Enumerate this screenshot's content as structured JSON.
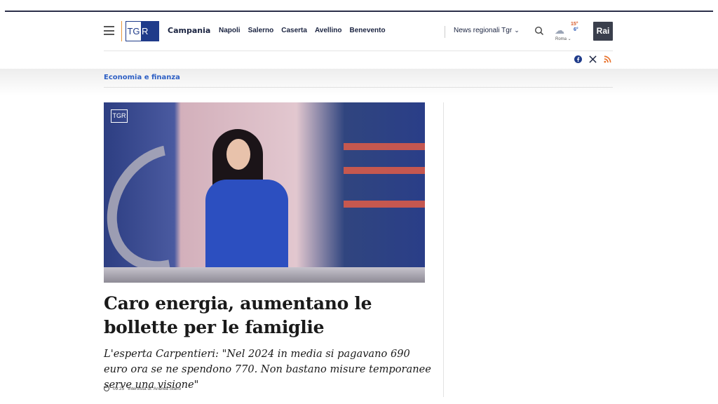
{
  "header": {
    "logo_tg": "TG",
    "logo_r": "R",
    "region": "Campania",
    "cities": [
      "Napoli",
      "Salerno",
      "Caserta",
      "Avellino",
      "Benevento"
    ],
    "news_regionali": "News regionali Tgr",
    "weather": {
      "temp_high": "15°",
      "temp_low": "6°",
      "city": "Roma"
    },
    "broadcaster_logo": "Rai"
  },
  "socials": [
    "facebook-icon",
    "x-icon",
    "rss-icon"
  ],
  "category": "Economia e finanza",
  "article": {
    "image_logo": "TGR",
    "headline": "Caro energia, aumentano le bollette per le famiglie",
    "subhead": "L'esperta Carpentieri: \"Nel 2024 in media si pagavano 690 euro ora se ne spendono 770. Non bastano misure temporanee serve una visione\"",
    "duration": "09:25",
    "credit": "Intervista di: Andrea Siano"
  },
  "colors": {
    "accent": "#2d5fc4",
    "brand": "#1f3b8a",
    "orange": "#e8973d"
  }
}
